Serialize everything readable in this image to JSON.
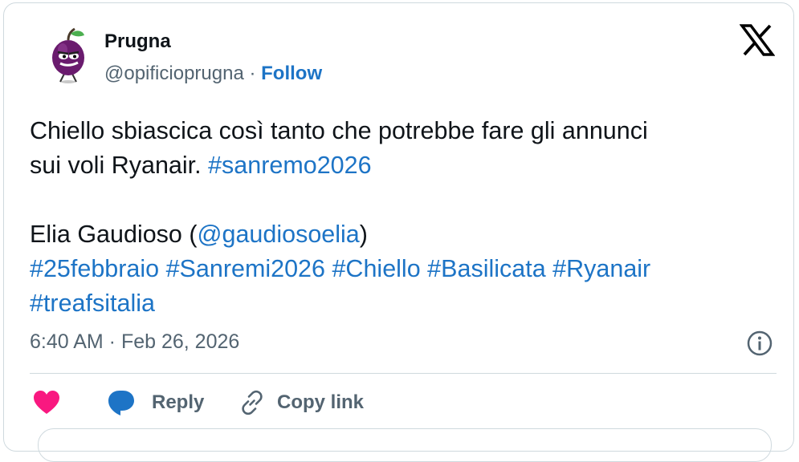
{
  "author": {
    "name": "Prugna",
    "handle": "@opificioprugna",
    "separator": " · ",
    "follow_label": "Follow"
  },
  "tweet": {
    "line1": "Chiello sbiascica così tanto che potrebbe fare gli annunci",
    "line2_text": "sui voli Ryanair. ",
    "line2_tag": "#sanremo2026",
    "credit_name": "Elia Gaudioso (",
    "credit_mention": "@gaudiosoelia",
    "credit_close": ")",
    "tags_line": [
      "#25febbraio",
      "#Sanremi2026",
      "#Chiello",
      "#Basilicata",
      "#Ryanair"
    ],
    "last_tag": "#treafsitalia"
  },
  "timestamp": "6:40 AM · Feb 26, 2026",
  "actions": {
    "reply_label": "Reply",
    "copy_label": "Copy link"
  },
  "colors": {
    "link": "#1d74c6",
    "like": "#f91880",
    "secondary_text": "#536471",
    "border": "#cfd9de"
  },
  "icons": [
    "x-logo-icon",
    "heart-icon",
    "reply-bubble-icon",
    "link-icon",
    "info-icon"
  ]
}
